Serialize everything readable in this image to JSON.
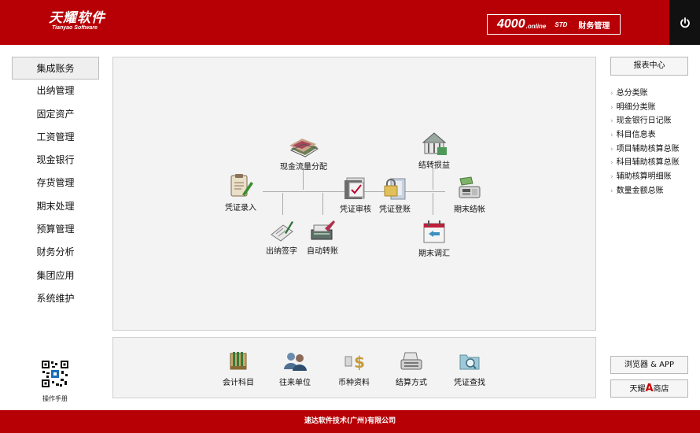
{
  "header": {
    "logo_cn": "天耀软件",
    "logo_en": "Tianyao Software",
    "product_number": "4000",
    "product_online": ".online",
    "product_edition": "STD",
    "product_module": "财务管理",
    "power_icon": "power-icon"
  },
  "nav": {
    "items": [
      {
        "label": "集成账务",
        "active": true
      },
      {
        "label": "出纳管理"
      },
      {
        "label": "固定资产"
      },
      {
        "label": "工资管理"
      },
      {
        "label": "现金银行"
      },
      {
        "label": "存货管理"
      },
      {
        "label": "期末处理"
      },
      {
        "label": "预算管理"
      },
      {
        "label": "财务分析"
      },
      {
        "label": "集团应用"
      },
      {
        "label": "系统维护"
      }
    ],
    "manual_label": "操作手册"
  },
  "flow": {
    "voucher_entry": "凭证录入",
    "cashflow_alloc": "现金流量分配",
    "cashier_sign": "出纳签字",
    "auto_transfer": "自动转账",
    "voucher_audit": "凭证审核",
    "voucher_post": "凭证登账",
    "transfer_pl": "结转损益",
    "period_adjust": "期末调汇",
    "period_close": "期末结帐"
  },
  "quick": {
    "items": [
      {
        "label": "会计科目",
        "icon": "ledger-icon"
      },
      {
        "label": "往来单位",
        "icon": "people-icon"
      },
      {
        "label": "币种资料",
        "icon": "currency-icon"
      },
      {
        "label": "结算方式",
        "icon": "cash-register-icon"
      },
      {
        "label": "凭证查找",
        "icon": "folder-search-icon"
      }
    ]
  },
  "reports": {
    "center_label": "报表中心",
    "links": [
      "总分类账",
      "明细分类账",
      "现金银行日记账",
      "科目信息表",
      "项目辅助核算总账",
      "科目辅助核算总账",
      "辅助核算明细账",
      "数量金额总账"
    ]
  },
  "side": {
    "browser_label": "浏览器 & APP",
    "shop_prefix": "天耀",
    "shop_letter": "A",
    "shop_suffix": "商店"
  },
  "footer": {
    "copyright": "速达软件技术(广州)有限公司"
  },
  "colors": {
    "brand_red": "#b70006",
    "panel_bg": "#f3f3f3",
    "power_bg": "#111111"
  }
}
